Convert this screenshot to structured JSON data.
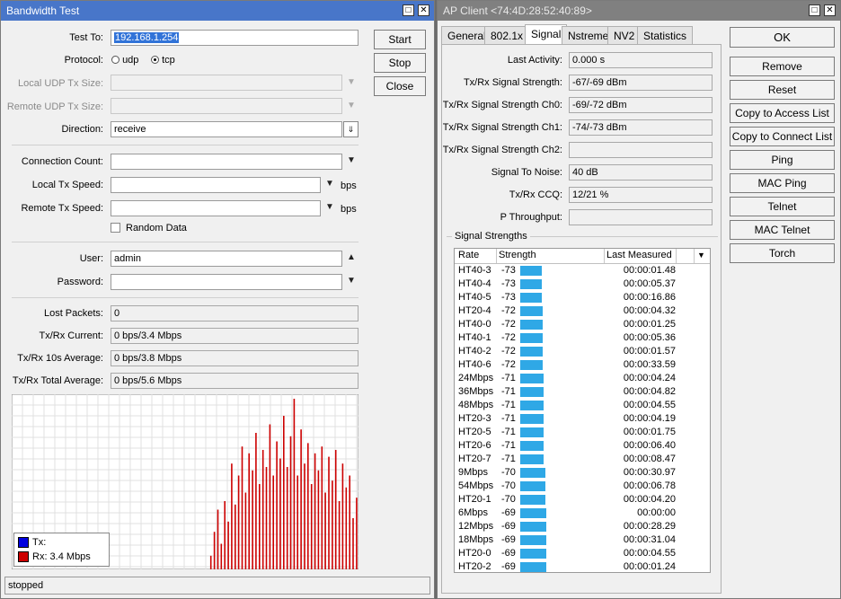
{
  "bandwidth_test": {
    "title": "Bandwidth Test",
    "test_to_label": "Test To:",
    "test_to_value": "192.168.1.254",
    "protocol_label": "Protocol:",
    "protocol_udp": "udp",
    "protocol_tcp": "tcp",
    "protocol_selected": "tcp",
    "local_udp_label": "Local UDP Tx Size:",
    "remote_udp_label": "Remote UDP Tx Size:",
    "direction_label": "Direction:",
    "direction_value": "receive",
    "connection_count_label": "Connection Count:",
    "local_tx_speed_label": "Local Tx Speed:",
    "remote_tx_speed_label": "Remote Tx Speed:",
    "bps_unit": "bps",
    "random_data_label": "Random Data",
    "user_label": "User:",
    "user_value": "admin",
    "password_label": "Password:",
    "lost_packets_label": "Lost Packets:",
    "lost_packets_value": "0",
    "current_label": "Tx/Rx Current:",
    "current_value": "0 bps/3.4 Mbps",
    "avg10_label": "Tx/Rx 10s Average:",
    "avg10_value": "0 bps/3.8 Mbps",
    "total_avg_label": "Tx/Rx Total Average:",
    "total_avg_value": "0 bps/5.6 Mbps",
    "buttons": {
      "start": "Start",
      "stop": "Stop",
      "close": "Close"
    },
    "legend": {
      "tx": "Tx:",
      "rx": "Rx:  3.4 Mbps",
      "tx_color": "#0000e0",
      "rx_color": "#cc0000"
    },
    "status": "stopped",
    "graph_rx": [
      0,
      0,
      0,
      0,
      0,
      0,
      0,
      0,
      0,
      0,
      0,
      0,
      0,
      0,
      0,
      0,
      0,
      0,
      0,
      0,
      0,
      0,
      0,
      0,
      0,
      0,
      0,
      0,
      0,
      0,
      0,
      0,
      0,
      0,
      0,
      0,
      0,
      0,
      0,
      0,
      0,
      0,
      0,
      0,
      0,
      0,
      0,
      0,
      0,
      0,
      0,
      0,
      0,
      0,
      0,
      0,
      0,
      0.08,
      0.22,
      0.35,
      0.15,
      0.4,
      0.28,
      0.62,
      0.38,
      0.55,
      0.72,
      0.45,
      0.68,
      0.58,
      0.8,
      0.5,
      0.7,
      0.6,
      0.85,
      0.55,
      0.75,
      0.65,
      0.9,
      0.6,
      0.78,
      1.0,
      0.55,
      0.82,
      0.62,
      0.74,
      0.5,
      0.68,
      0.58,
      0.72,
      0.45,
      0.66,
      0.52,
      0.7,
      0.4,
      0.62,
      0.48,
      0.55,
      0.3,
      0.42
    ]
  },
  "ap_client": {
    "title": "AP Client <74:4D:28:52:40:89>",
    "tabs": [
      "General",
      "802.1x",
      "Signal",
      "Nstreme",
      "NV2",
      "Statistics"
    ],
    "active_tab": "Signal",
    "fields": [
      {
        "label": "Last Activity:",
        "value": "0.000 s"
      },
      {
        "label": "Tx/Rx Signal Strength:",
        "value": "-67/-69 dBm"
      },
      {
        "label": "Tx/Rx Signal Strength Ch0:",
        "value": "-69/-72 dBm"
      },
      {
        "label": "Tx/Rx Signal Strength Ch1:",
        "value": "-74/-73 dBm"
      },
      {
        "label": "Tx/Rx Signal Strength Ch2:",
        "value": ""
      },
      {
        "label": "Signal To Noise:",
        "value": "40 dB"
      },
      {
        "label": "Tx/Rx CCQ:",
        "value": "12/21 %"
      },
      {
        "label": "P Throughput:",
        "value": ""
      }
    ],
    "signal_strengths_label": "Signal Strengths",
    "table_headers": {
      "rate": "Rate",
      "strength": "Strength",
      "last_measured": "Last Measured"
    },
    "rows": [
      {
        "rate": "HT40-3",
        "strength": "-73",
        "last": "00:00:01.48"
      },
      {
        "rate": "HT40-4",
        "strength": "-73",
        "last": "00:00:05.37"
      },
      {
        "rate": "HT40-5",
        "strength": "-73",
        "last": "00:00:16.86"
      },
      {
        "rate": "HT20-4",
        "strength": "-72",
        "last": "00:00:04.32"
      },
      {
        "rate": "HT40-0",
        "strength": "-72",
        "last": "00:00:01.25"
      },
      {
        "rate": "HT40-1",
        "strength": "-72",
        "last": "00:00:05.36"
      },
      {
        "rate": "HT40-2",
        "strength": "-72",
        "last": "00:00:01.57"
      },
      {
        "rate": "HT40-6",
        "strength": "-72",
        "last": "00:00:33.59"
      },
      {
        "rate": "24Mbps",
        "strength": "-71",
        "last": "00:00:04.24"
      },
      {
        "rate": "36Mbps",
        "strength": "-71",
        "last": "00:00:04.82"
      },
      {
        "rate": "48Mbps",
        "strength": "-71",
        "last": "00:00:04.55"
      },
      {
        "rate": "HT20-3",
        "strength": "-71",
        "last": "00:00:04.19"
      },
      {
        "rate": "HT20-5",
        "strength": "-71",
        "last": "00:00:01.75"
      },
      {
        "rate": "HT20-6",
        "strength": "-71",
        "last": "00:00:06.40"
      },
      {
        "rate": "HT20-7",
        "strength": "-71",
        "last": "00:00:08.47"
      },
      {
        "rate": "9Mbps",
        "strength": "-70",
        "last": "00:00:30.97"
      },
      {
        "rate": "54Mbps",
        "strength": "-70",
        "last": "00:00:06.78"
      },
      {
        "rate": "HT20-1",
        "strength": "-70",
        "last": "00:00:04.20"
      },
      {
        "rate": "6Mbps",
        "strength": "-69",
        "last": "00:00:00"
      },
      {
        "rate": "12Mbps",
        "strength": "-69",
        "last": "00:00:28.29"
      },
      {
        "rate": "18Mbps",
        "strength": "-69",
        "last": "00:00:31.04"
      },
      {
        "rate": "HT20-0",
        "strength": "-69",
        "last": "00:00:04.55"
      },
      {
        "rate": "HT20-2",
        "strength": "-69",
        "last": "00:00:01.24"
      }
    ],
    "buttons": [
      "OK",
      "Remove",
      "Reset",
      "Copy to Access List",
      "Copy to Connect List",
      "Ping",
      "MAC Ping",
      "Telnet",
      "MAC Telnet",
      "Torch"
    ],
    "bar_color": "#2fa8e6"
  }
}
